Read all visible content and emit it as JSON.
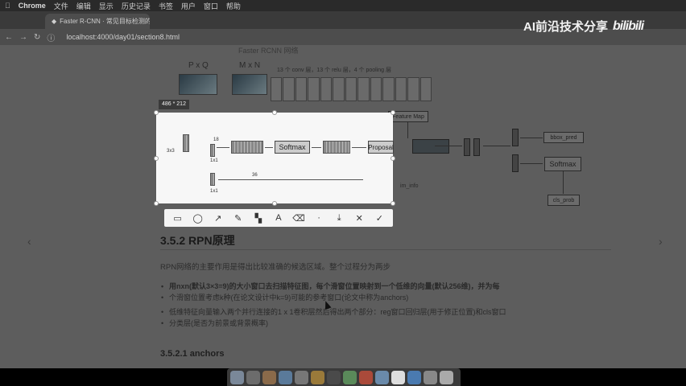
{
  "menubar": {
    "app_name": "Chrome",
    "items": [
      "文件",
      "编辑",
      "显示",
      "历史记录",
      "书签",
      "用户",
      "窗口",
      "帮助"
    ]
  },
  "browser": {
    "tab_title": "Faster R-CNN · 常见目标检测的…",
    "url": "localhost:4000/day01/section8.html"
  },
  "watermark": {
    "text": "AI前沿技术分享",
    "brand": "bilibili"
  },
  "diagram": {
    "title": "Faster RCNN 网络",
    "pxq": "P x Q",
    "mxn": "M x N",
    "conv_text": "13 个 conv 层，13 个 relu 层，4 个 pooling 层",
    "feature_map": "Feature Map",
    "bbox_pred": "bbox_pred",
    "softmax_right": "Softmax",
    "cls_prob": "cls_prob",
    "im_info": "im_info"
  },
  "selection": {
    "size_label": "486 * 212",
    "softmax": "Softmax",
    "proposal": "Proposal",
    "label_3x3": "3x3",
    "label_18": "18",
    "label_36": "36",
    "label_1x1a": "1x1",
    "label_1x1b": "1x1"
  },
  "toolbar": {
    "tools": [
      "rectangle-tool",
      "ellipse-tool",
      "arrow-tool",
      "pen-tool",
      "mosaic-tool",
      "text-tool",
      "eraser-tool",
      "download-tool",
      "cancel-tool",
      "confirm-tool"
    ]
  },
  "doc": {
    "heading": "3.5.2 RPN原理",
    "intro": "RPN网络的主要作用是得出比较准确的候选区域。整个过程分为两步",
    "bullet1_line1": "用nxn(默认3×3=9)的大小窗口去扫描特征图，每个滑窗位置映射到一个低维的向量(默认256维)，并为每",
    "bullet1_line2": "个滑窗位置考虑k种(在论文设计中k=9)可能的参考窗口(论文中称为anchors)",
    "bullet2_line1": "低维特征向量输入两个并行连接的1 x 1卷积层然后得出两个部分：reg窗口回归层(用于修正位置)和cls窗口",
    "bullet2_line2": "分类层(是否为前景或背景概率)",
    "subheading": "3.5.2.1 anchors"
  },
  "colors": {
    "overlay_bg": "#5d5d5d",
    "selection_bg": "#f7f7f7"
  }
}
